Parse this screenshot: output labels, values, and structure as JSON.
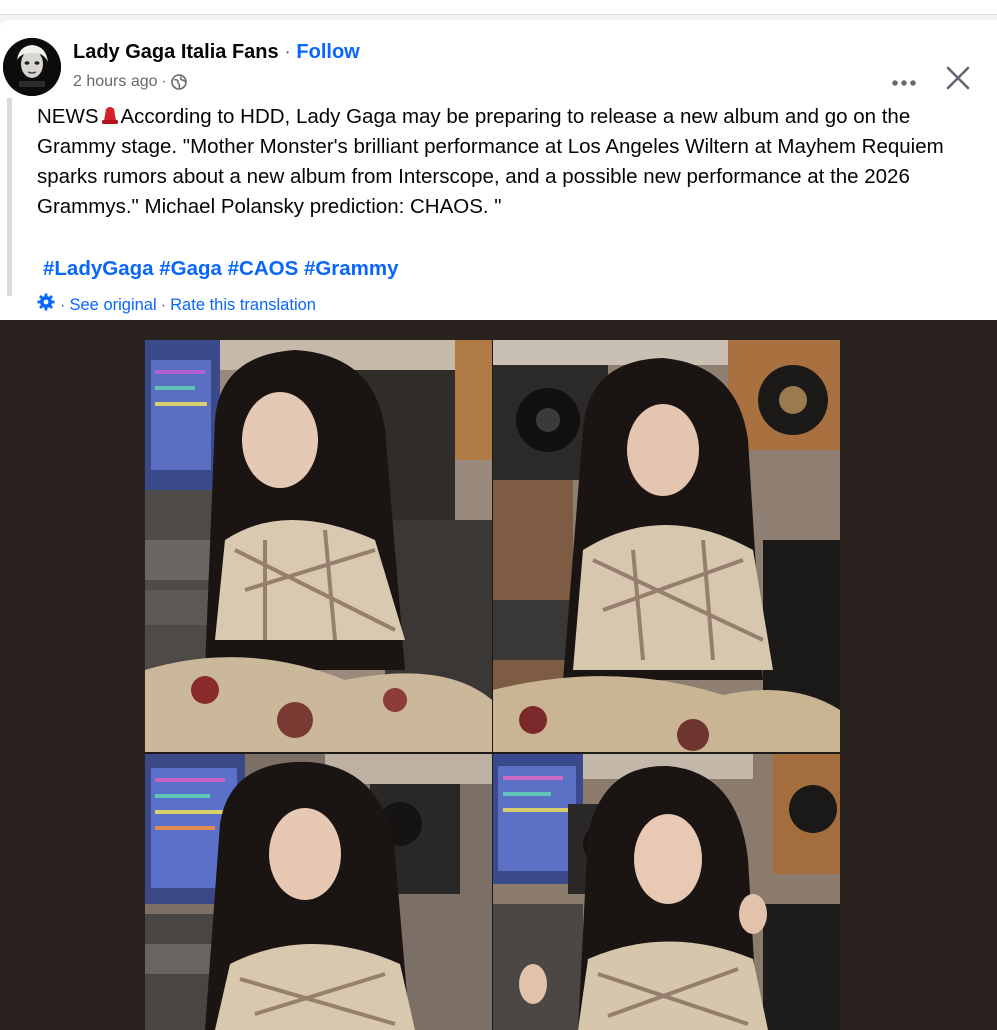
{
  "post": {
    "author": "Lady Gaga Italia Fans",
    "separator": "·",
    "follow_label": "Follow",
    "timestamp": "2 hours ago",
    "audience_separator": "·",
    "text_before_emoji": "NEWS",
    "text_after_emoji": "According to HDD, Lady Gaga may be preparing to release a new album and go on the Grammy stage. \"Mother Monster's brilliant performance at Los Angeles Wiltern at Mayhem Requiem sparks rumors about a new album from Interscope, and a possible new performance at the 2026 Grammys.\" Michael Polansky prediction: CHAOS. \"",
    "hashtags": [
      "#LadyGaga",
      "#Gaga",
      "#CAOS",
      "#Grammy"
    ],
    "translation": {
      "see_original": "See original",
      "rate": "Rate this translation",
      "sep": "·"
    },
    "icons": {
      "avatar": "avatar-image",
      "globe": "globe-icon",
      "more": "more-horizontal-icon",
      "close": "close-icon",
      "translate": "gear-icon",
      "emoji": "red-hat-emoji"
    },
    "colors": {
      "link": "#0866ff",
      "secondary_text": "#65676b",
      "media_background": "#2a221f"
    }
  },
  "media": {
    "photos": [
      "studio-interview-photo-1",
      "studio-interview-photo-2",
      "studio-interview-photo-3",
      "studio-interview-photo-4"
    ]
  }
}
